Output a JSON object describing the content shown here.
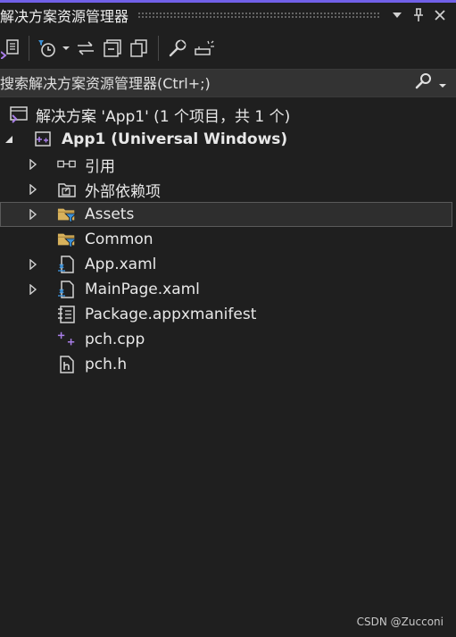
{
  "panel": {
    "title": "解决方案资源管理器",
    "pin_icon": "pin-icon",
    "close_icon": "close-icon",
    "dropdown_icon": "chevron-down-icon"
  },
  "toolbar": {
    "icons": [
      "solution-view-icon",
      "pending-changes-filter-icon",
      "dropdown-arrow-icon",
      "sync-icon",
      "collapse-all-icon",
      "show-all-files-icon",
      "properties-icon",
      "preview-icon"
    ]
  },
  "search": {
    "placeholder": "搜索解决方案资源管理器(Ctrl+;)",
    "search_icon": "search-icon"
  },
  "tree": {
    "solution": "解决方案 'App1' (1 个项目，共 1 个)",
    "project": "App1 (Universal Windows)",
    "items": [
      {
        "label": "引用",
        "icon": "references-icon"
      },
      {
        "label": "外部依赖项",
        "icon": "external-dependencies-icon"
      },
      {
        "label": "Assets",
        "icon": "filter-folder-icon"
      },
      {
        "label": "Common",
        "icon": "filter-folder-icon"
      },
      {
        "label": "App.xaml",
        "icon": "xaml-file-icon"
      },
      {
        "label": "MainPage.xaml",
        "icon": "xaml-file-icon"
      },
      {
        "label": "Package.appxmanifest",
        "icon": "manifest-file-icon"
      },
      {
        "label": "pch.cpp",
        "icon": "cpp-file-icon"
      },
      {
        "label": "pch.h",
        "icon": "header-file-icon"
      }
    ]
  },
  "colors": {
    "accent": "#7160e8",
    "background": "#1f1f1f",
    "selection": "#2e2e2e",
    "folder": "#d8b25c",
    "filter": "#3a8fd6"
  },
  "watermark": "CSDN @Zucconi"
}
